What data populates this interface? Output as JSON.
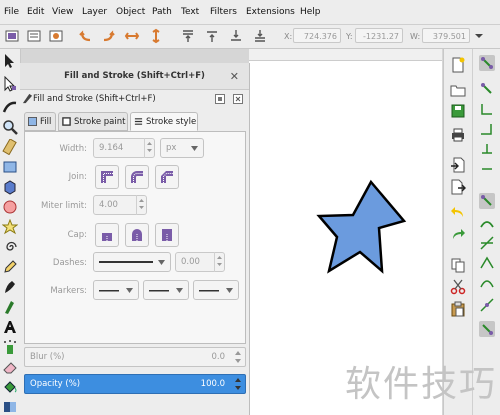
{
  "menu": [
    "File",
    "Edit",
    "View",
    "Layer",
    "Object",
    "Path",
    "Text",
    "Filters",
    "Extensions",
    "Help"
  ],
  "coords": {
    "x_label": "X:",
    "x_value": "724.376",
    "y_label": "Y:",
    "y_value": "-1231.27",
    "w_label": "W:",
    "w_value": "379.501"
  },
  "dialog": {
    "title": "Fill and Stroke (Shift+Ctrl+F)",
    "subtitle": "Fill and Stroke (Shift+Ctrl+F)",
    "tabs": [
      {
        "label": "Fill",
        "active": false
      },
      {
        "label": "Stroke paint",
        "active": false
      },
      {
        "label": "Stroke style",
        "active": true
      }
    ],
    "width_label": "Width:",
    "width_value": "9.164",
    "unit": "px",
    "join_label": "Join:",
    "miter_label": "Miter limit:",
    "miter_value": "4.00",
    "cap_label": "Cap:",
    "dashes_label": "Dashes:",
    "dash_offset": "0.00",
    "markers_label": "Markers:",
    "blur_label": "Blur (%)",
    "blur_value": "0.0",
    "opacity_label": "Opacity (%)",
    "opacity_value": "100.0"
  },
  "watermark": "软件技巧",
  "colors": {
    "accent": "#3d8ee0",
    "star_fill": "#6b9bde",
    "star_stroke": "#000000",
    "icon_purple": "#7a5ca8",
    "icon_green": "#3a9a3a",
    "icon_orange": "#d87a30"
  }
}
